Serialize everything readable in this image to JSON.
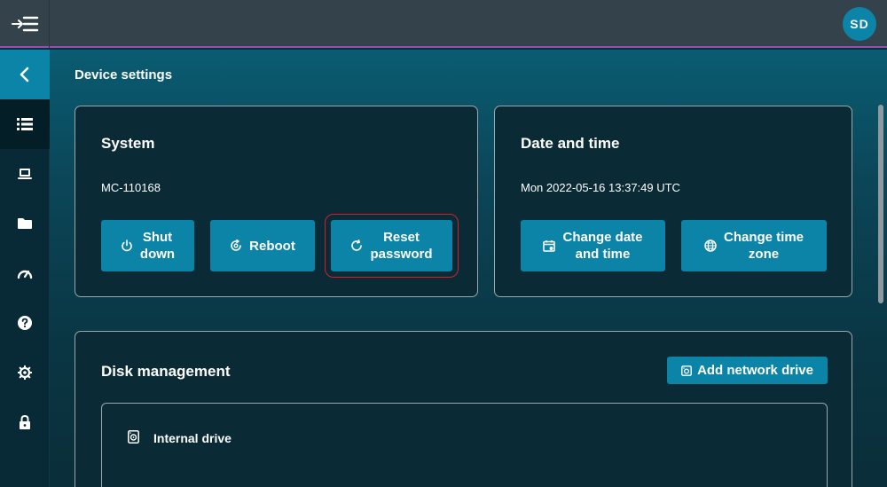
{
  "header": {
    "menu_icon": "menu-collapse-icon",
    "avatar_initials": "SD"
  },
  "sidebar": {
    "items": [
      {
        "name": "back",
        "icon": "chevron-left-icon"
      },
      {
        "name": "device-settings",
        "icon": "list-icon",
        "active": true
      },
      {
        "name": "device",
        "icon": "laptop-icon"
      },
      {
        "name": "files",
        "icon": "folder-icon"
      },
      {
        "name": "performance",
        "icon": "speedometer-icon"
      },
      {
        "name": "help",
        "icon": "help-icon"
      },
      {
        "name": "settings",
        "icon": "gear-icon"
      },
      {
        "name": "lock",
        "icon": "lock-icon"
      }
    ]
  },
  "page": {
    "title": "Device settings"
  },
  "system": {
    "title": "System",
    "device_id": "MC-110168",
    "shutdown_label": "Shut\ndown",
    "reboot_label": "Reboot",
    "reset_password_label": "Reset\npassword"
  },
  "datetime": {
    "title": "Date and time",
    "current": "Mon 2022-05-16 13:37:49 UTC",
    "change_datetime_label": "Change date\nand time",
    "change_timezone_label": "Change time\nzone"
  },
  "disk": {
    "title": "Disk management",
    "add_network_drive_label": "Add network drive",
    "internal_drive_label": "Internal drive"
  },
  "colors": {
    "accent": "#0b84a8",
    "topbar": "#34434b",
    "focus_ring": "#d02030"
  }
}
